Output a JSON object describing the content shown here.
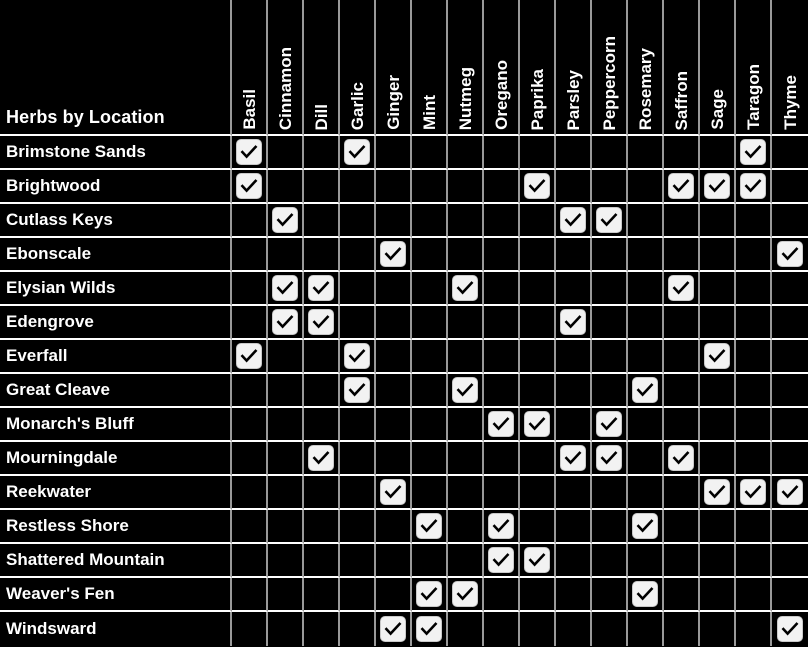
{
  "table": {
    "corner_label": "Herbs by Location",
    "columns": [
      "Basil",
      "Cinnamon",
      "Dill",
      "Garlic",
      "Ginger",
      "Mint",
      "Nutmeg",
      "Oregano",
      "Paprika",
      "Parsley",
      "Peppercorn",
      "Rosemary",
      "Saffron",
      "Sage",
      "Taragon",
      "Thyme"
    ],
    "rows": [
      {
        "label": "Brimstone Sands",
        "checks": [
          1,
          0,
          0,
          1,
          0,
          0,
          0,
          0,
          0,
          0,
          0,
          0,
          0,
          0,
          1,
          0
        ]
      },
      {
        "label": "Brightwood",
        "checks": [
          1,
          0,
          0,
          0,
          0,
          0,
          0,
          0,
          1,
          0,
          0,
          0,
          1,
          1,
          1,
          0
        ]
      },
      {
        "label": "Cutlass Keys",
        "checks": [
          0,
          1,
          0,
          0,
          0,
          0,
          0,
          0,
          0,
          1,
          1,
          0,
          0,
          0,
          0,
          0
        ]
      },
      {
        "label": "Ebonscale",
        "checks": [
          0,
          0,
          0,
          0,
          1,
          0,
          0,
          0,
          0,
          0,
          0,
          0,
          0,
          0,
          0,
          1
        ]
      },
      {
        "label": "Elysian Wilds",
        "checks": [
          0,
          1,
          1,
          0,
          0,
          0,
          1,
          0,
          0,
          0,
          0,
          0,
          1,
          0,
          0,
          0
        ]
      },
      {
        "label": "Edengrove",
        "checks": [
          0,
          1,
          1,
          0,
          0,
          0,
          0,
          0,
          0,
          1,
          0,
          0,
          0,
          0,
          0,
          0
        ]
      },
      {
        "label": "Everfall",
        "checks": [
          1,
          0,
          0,
          1,
          0,
          0,
          0,
          0,
          0,
          0,
          0,
          0,
          0,
          1,
          0,
          0
        ]
      },
      {
        "label": "Great Cleave",
        "checks": [
          0,
          0,
          0,
          1,
          0,
          0,
          1,
          0,
          0,
          0,
          0,
          1,
          0,
          0,
          0,
          0
        ]
      },
      {
        "label": "Monarch's Bluff",
        "checks": [
          0,
          0,
          0,
          0,
          0,
          0,
          0,
          1,
          1,
          0,
          1,
          0,
          0,
          0,
          0,
          0
        ]
      },
      {
        "label": "Mourningdale",
        "checks": [
          0,
          0,
          1,
          0,
          0,
          0,
          0,
          0,
          0,
          1,
          1,
          0,
          1,
          0,
          0,
          0
        ]
      },
      {
        "label": "Reekwater",
        "checks": [
          0,
          0,
          0,
          0,
          1,
          0,
          0,
          0,
          0,
          0,
          0,
          0,
          0,
          1,
          1,
          1
        ]
      },
      {
        "label": "Restless Shore",
        "checks": [
          0,
          0,
          0,
          0,
          0,
          1,
          0,
          1,
          0,
          0,
          0,
          1,
          0,
          0,
          0,
          0
        ]
      },
      {
        "label": "Shattered Mountain",
        "checks": [
          0,
          0,
          0,
          0,
          0,
          0,
          0,
          1,
          1,
          0,
          0,
          0,
          0,
          0,
          0,
          0
        ]
      },
      {
        "label": "Weaver's Fen",
        "checks": [
          0,
          0,
          0,
          0,
          0,
          1,
          1,
          0,
          0,
          0,
          0,
          1,
          0,
          0,
          0,
          0
        ]
      },
      {
        "label": "Windsward",
        "checks": [
          0,
          0,
          0,
          0,
          1,
          1,
          0,
          0,
          0,
          0,
          0,
          0,
          0,
          0,
          0,
          1
        ]
      }
    ],
    "checkbox_icon": "checkbox-checked-icon",
    "colors": {
      "background": "#000000",
      "text": "#ffffff",
      "gridline_vertical": "#9a9a9a",
      "gridline_horizontal": "#ffffff",
      "checkbox_fill": "#f2f2f2",
      "checkmark": "#000000"
    }
  }
}
